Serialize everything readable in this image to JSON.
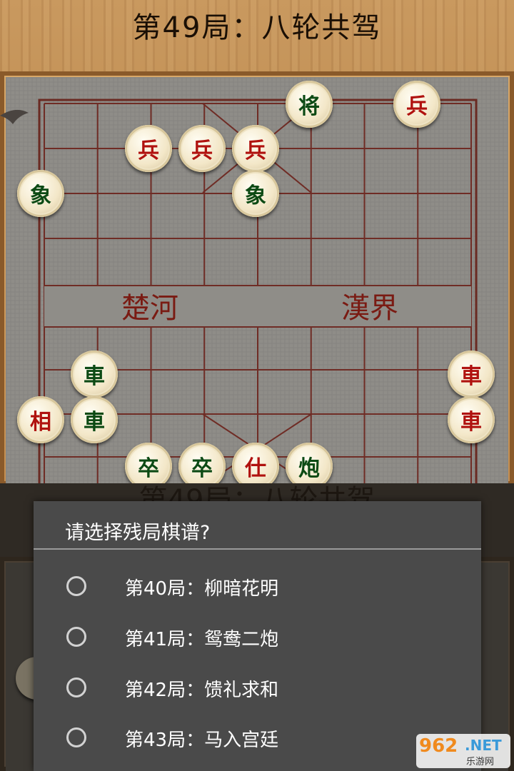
{
  "header": {
    "title": "第49局：八轮共驾"
  },
  "board": {
    "river_left": "楚河",
    "river_right": "漢界",
    "pieces": [
      {
        "char": "将",
        "side": "black"
      },
      {
        "char": "兵",
        "side": "red"
      },
      {
        "char": "兵",
        "side": "red"
      },
      {
        "char": "兵",
        "side": "red"
      },
      {
        "char": "兵",
        "side": "red"
      },
      {
        "char": "象",
        "side": "black"
      },
      {
        "char": "象",
        "side": "black"
      },
      {
        "char": "車",
        "side": "black"
      },
      {
        "char": "車",
        "side": "red"
      },
      {
        "char": "相",
        "side": "red"
      },
      {
        "char": "車",
        "side": "black"
      },
      {
        "char": "車",
        "side": "red"
      },
      {
        "char": "卒",
        "side": "black"
      },
      {
        "char": "卒",
        "side": "black"
      },
      {
        "char": "仕",
        "side": "red"
      },
      {
        "char": "炮",
        "side": "black"
      }
    ]
  },
  "background": {
    "ghost_title": "第49局：八轮共驾"
  },
  "dialog": {
    "title": "请选择残局棋谱?",
    "options": [
      {
        "label": "第40局：柳暗花明",
        "selected": false
      },
      {
        "label": "第41局：鸳鸯二炮",
        "selected": false
      },
      {
        "label": "第42局：馈礼求和",
        "selected": false
      },
      {
        "label": "第43局：马入宫廷",
        "selected": false
      }
    ]
  },
  "watermark": {
    "logo": "962",
    "net": ".NET",
    "sub": "乐游网"
  },
  "colors": {
    "red_piece": "#b0120f",
    "black_piece": "#0c4a14",
    "dialog_bg": "#4a4a4a"
  }
}
